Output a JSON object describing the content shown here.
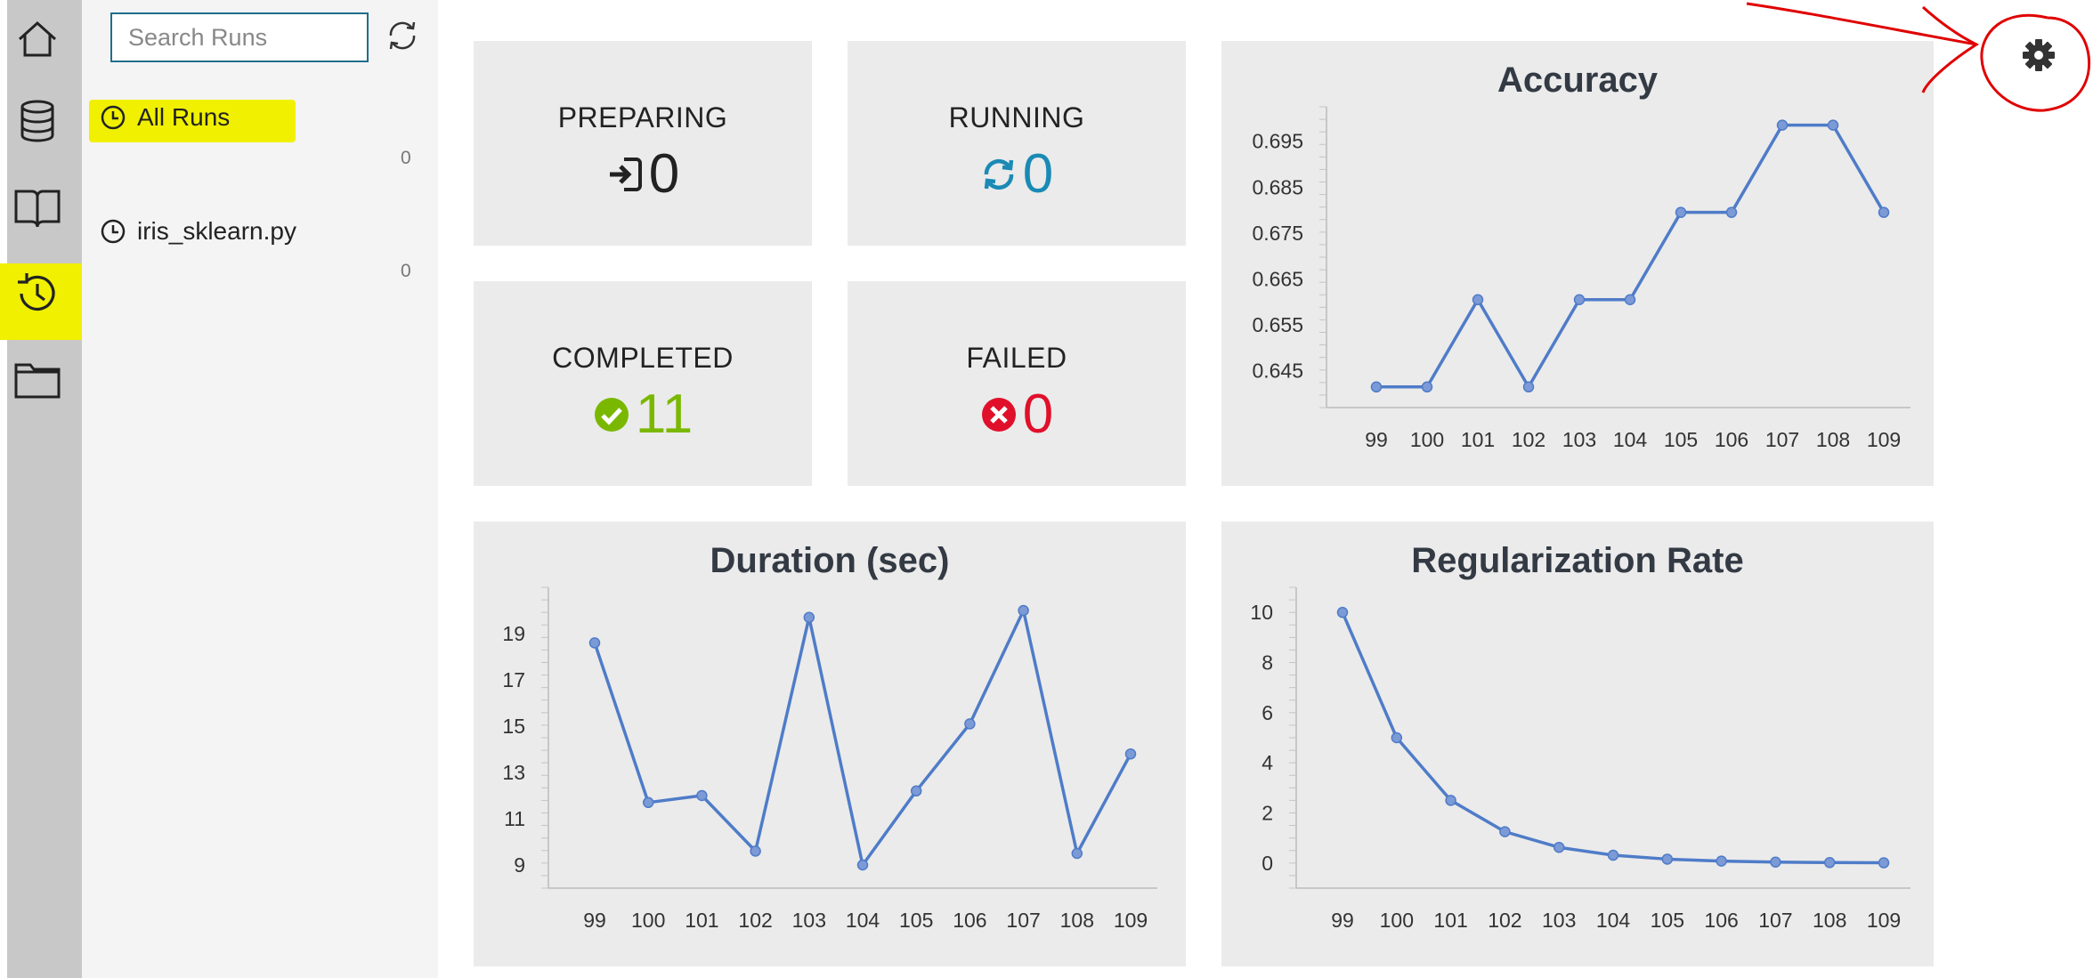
{
  "sidebar": {
    "icons": [
      "home-icon",
      "database-icon",
      "book-icon",
      "history-icon",
      "folder-icon"
    ],
    "highlight_color": "#f0f000"
  },
  "runs": {
    "search_placeholder": "Search Runs",
    "items": [
      {
        "label": "All Runs",
        "count": "0"
      },
      {
        "label": "iris_sklearn.py",
        "count": "0"
      }
    ]
  },
  "stats": {
    "preparing": {
      "label": "PREPARING",
      "value": "0",
      "color": "#222222"
    },
    "running": {
      "label": "RUNNING",
      "value": "0",
      "color": "#1a8ab5"
    },
    "completed": {
      "label": "COMPLETED",
      "value": "11",
      "color": "#7ab800"
    },
    "failed": {
      "label": "FAILED",
      "value": "0",
      "color": "#e0102b"
    }
  },
  "annotation_color": "#e00000",
  "chart_data": [
    {
      "type": "line",
      "title": "Accuracy",
      "x": [
        99,
        100,
        101,
        102,
        103,
        104,
        105,
        106,
        107,
        108,
        109
      ],
      "values": [
        0.6415,
        0.6415,
        0.6605,
        0.6415,
        0.6605,
        0.6605,
        0.6795,
        0.6795,
        0.6985,
        0.6985,
        0.6795
      ],
      "yticks": [
        "0.645",
        "0.655",
        "0.665",
        "0.675",
        "0.685",
        "0.695"
      ],
      "ylim": [
        0.637,
        0.7025
      ],
      "color": "#4f7cc8"
    },
    {
      "type": "line",
      "title": "Duration (sec)",
      "x": [
        99,
        100,
        101,
        102,
        103,
        104,
        105,
        106,
        107,
        108,
        109
      ],
      "values": [
        18.6,
        11.7,
        12.0,
        9.6,
        19.7,
        9.0,
        12.2,
        15.1,
        20.0,
        9.5,
        13.8
      ],
      "yticks": [
        "9",
        "11",
        "13",
        "15",
        "17",
        "19"
      ],
      "ylim": [
        8.0,
        21.0
      ],
      "color": "#4f7cc8"
    },
    {
      "type": "line",
      "title": "Regularization Rate",
      "x": [
        99,
        100,
        101,
        102,
        103,
        104,
        105,
        106,
        107,
        108,
        109
      ],
      "values": [
        10,
        5,
        2.5,
        1.25,
        0.625,
        0.3125,
        0.156,
        0.078,
        0.039,
        0.02,
        0.01
      ],
      "yticks": [
        "0",
        "2",
        "4",
        "6",
        "8",
        "10"
      ],
      "ylim": [
        -1.0,
        11.0
      ],
      "color": "#4f7cc8"
    }
  ]
}
